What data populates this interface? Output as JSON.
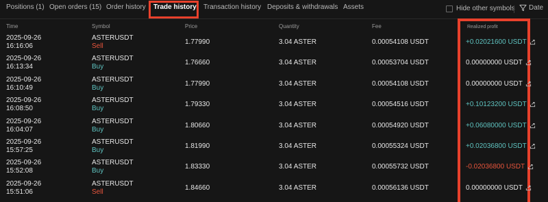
{
  "tabs": [
    {
      "label": "Positions (1)"
    },
    {
      "label": "Open orders (15)"
    },
    {
      "label": "Order history"
    },
    {
      "label": "Trade history"
    },
    {
      "label": "Transaction history"
    },
    {
      "label": "Deposits & withdrawals"
    },
    {
      "label": "Assets"
    }
  ],
  "active_tab": "Trade history",
  "filters": {
    "hide_other_symbols_label": "Hide other symbols",
    "hide_other_symbols_checked": false,
    "date_label": "Date"
  },
  "columns": {
    "time": "Time",
    "symbol": "Symbol",
    "price": "Price",
    "quantity": "Quantity",
    "fee": "Fee",
    "realized_profit": "Realized profit"
  },
  "colors": {
    "buy": "#5fc3c0",
    "sell": "#e8553c",
    "profit_positive": "#5fc3c0",
    "profit_negative": "#e8553c",
    "highlight": "#e8412c"
  },
  "rows": [
    {
      "date": "2025-09-26",
      "time": "16:16:06",
      "symbol": "ASTERUSDT",
      "side": "Sell",
      "price": "1.77990",
      "quantity": "3.04 ASTER",
      "fee": "0.00054108 USDT",
      "profit": "+0.02021600 USDT"
    },
    {
      "date": "2025-09-26",
      "time": "16:13:34",
      "symbol": "ASTERUSDT",
      "side": "Buy",
      "price": "1.76660",
      "quantity": "3.04 ASTER",
      "fee": "0.00053704 USDT",
      "profit": "0.00000000 USDT"
    },
    {
      "date": "2025-09-26",
      "time": "16:10:49",
      "symbol": "ASTERUSDT",
      "side": "Buy",
      "price": "1.77990",
      "quantity": "3.04 ASTER",
      "fee": "0.00054108 USDT",
      "profit": "0.00000000 USDT"
    },
    {
      "date": "2025-09-26",
      "time": "16:08:50",
      "symbol": "ASTERUSDT",
      "side": "Buy",
      "price": "1.79330",
      "quantity": "3.04 ASTER",
      "fee": "0.00054516 USDT",
      "profit": "+0.10123200 USDT"
    },
    {
      "date": "2025-09-26",
      "time": "16:04:07",
      "symbol": "ASTERUSDT",
      "side": "Buy",
      "price": "1.80660",
      "quantity": "3.04 ASTER",
      "fee": "0.00054920 USDT",
      "profit": "+0.06080000 USDT"
    },
    {
      "date": "2025-09-26",
      "time": "15:57:25",
      "symbol": "ASTERUSDT",
      "side": "Buy",
      "price": "1.81990",
      "quantity": "3.04 ASTER",
      "fee": "0.00055324 USDT",
      "profit": "+0.02036800 USDT"
    },
    {
      "date": "2025-09-26",
      "time": "15:52:08",
      "symbol": "ASTERUSDT",
      "side": "Buy",
      "price": "1.83330",
      "quantity": "3.04 ASTER",
      "fee": "0.00055732 USDT",
      "profit": "-0.02036800 USDT"
    },
    {
      "date": "2025-09-26",
      "time": "15:51:06",
      "symbol": "ASTERUSDT",
      "side": "Sell",
      "price": "1.84660",
      "quantity": "3.04 ASTER",
      "fee": "0.00056136 USDT",
      "profit": "0.00000000 USDT"
    }
  ]
}
